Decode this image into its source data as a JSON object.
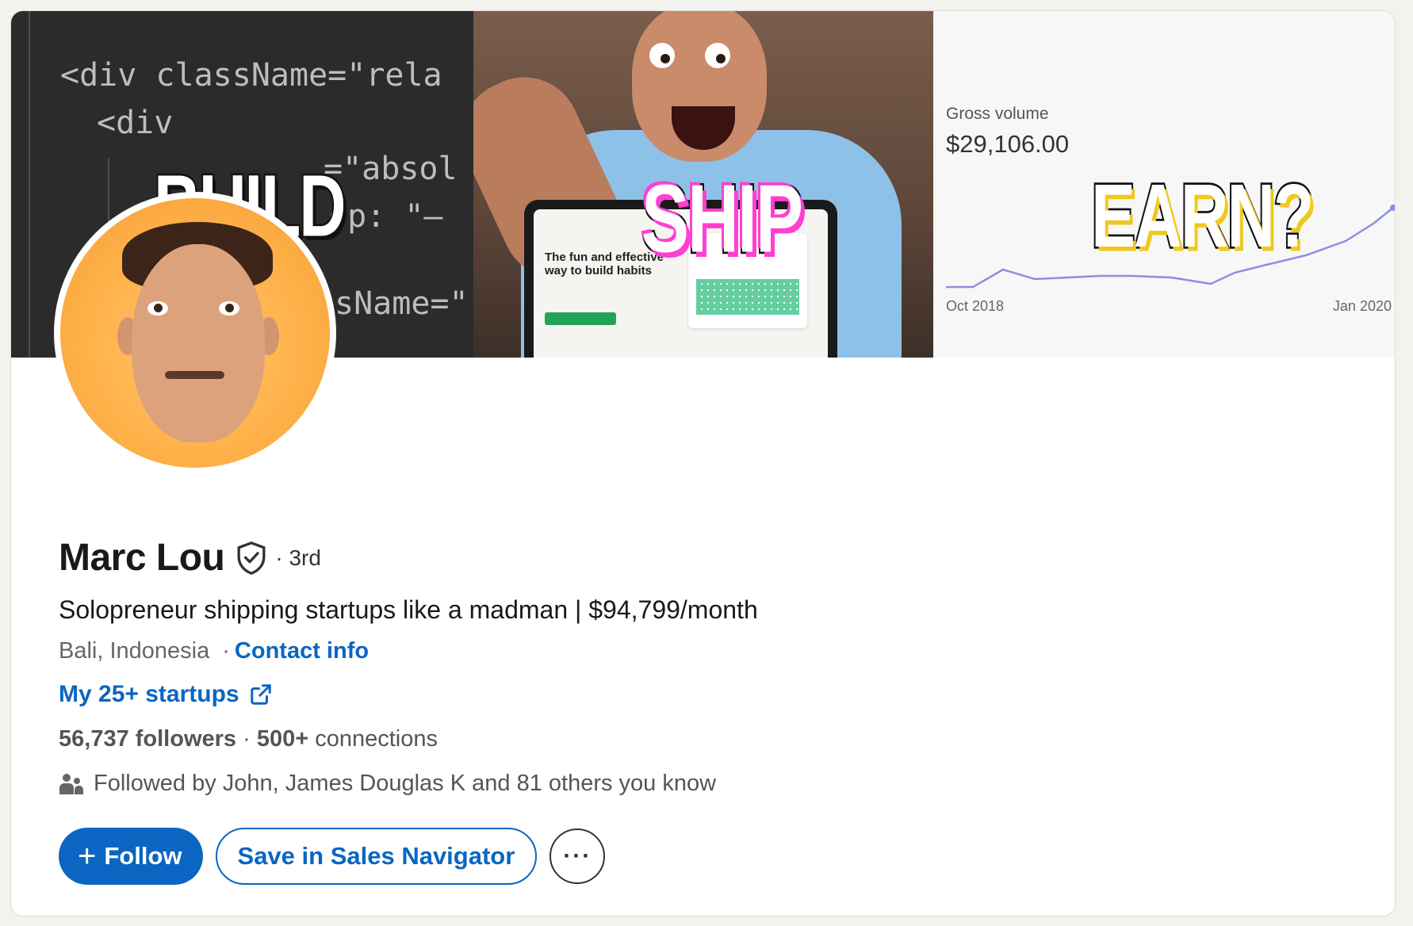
{
  "banner": {
    "code_lines": [
      "<div className=\"rela",
      "<div",
      "=\"absol",
      "op: \"–",
      "sName=\""
    ],
    "words": {
      "build": "BUILD",
      "ship": "SHIP",
      "earn": "EARN?"
    },
    "tablet": {
      "title": "The fun and effective way to build habits"
    },
    "revenue": {
      "label": "Gross volume",
      "value": "$29,106.00",
      "axis_start": "Oct 2018",
      "axis_end": "Jan 2020"
    }
  },
  "profile": {
    "name": "Marc Lou",
    "degree": "· 3rd",
    "headline": "Solopreneur shipping startups like a madman | $94,799/month",
    "location": "Bali, Indonesia",
    "location_sep": "·",
    "contact_label": "Contact info",
    "website_label": "My 25+ startups",
    "followers": "56,737 followers",
    "stats_sep": " · ",
    "connections_count": "500+",
    "connections_label": " connections",
    "mutual": "Followed by John, James Douglas K and 81 others you know"
  },
  "actions": {
    "follow_plus": "+",
    "follow_label": "Follow",
    "sales_label": "Save in Sales Navigator",
    "more_label": "···"
  },
  "icons": {
    "verified": "verified-shield-icon",
    "external": "external-link-icon",
    "people": "people-icon",
    "more": "more-horizontal-icon"
  },
  "colors": {
    "accent": "#0a66c2",
    "background": "#f3f2ef",
    "chart_line": "#8c8fe0"
  }
}
